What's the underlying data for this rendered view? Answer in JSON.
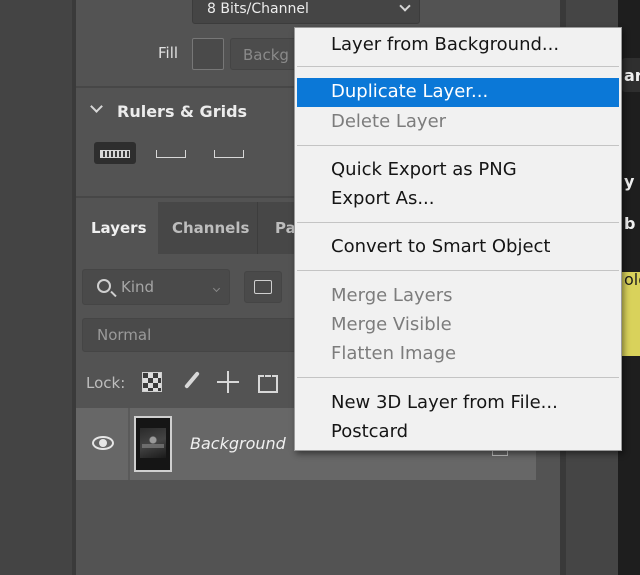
{
  "properties": {
    "bit_depth": "8 Bits/Channel",
    "fill_label": "Fill",
    "fill_value": "Backg",
    "rulers_grids_title": "Rulers & Grids"
  },
  "layers_panel": {
    "tabs": [
      {
        "label": "Layers"
      },
      {
        "label": "Channels"
      },
      {
        "label": "Pa"
      }
    ],
    "filter_kind": "Kind",
    "blend_mode": "Normal",
    "lock_label": "Lock:",
    "layer": {
      "name": "Background"
    }
  },
  "right_panel": {
    "fragments": [
      "ari",
      "y",
      "b",
      "olo"
    ]
  },
  "context_menu": {
    "items": [
      {
        "label": "Layer from Background...",
        "state": "enabled"
      },
      {
        "label": "Duplicate Layer...",
        "state": "highlighted"
      },
      {
        "label": "Delete Layer",
        "state": "disabled"
      },
      {
        "label": "Quick Export as PNG",
        "state": "enabled"
      },
      {
        "label": "Export As...",
        "state": "enabled"
      },
      {
        "label": "Convert to Smart Object",
        "state": "enabled"
      },
      {
        "label": "Merge Layers",
        "state": "disabled"
      },
      {
        "label": "Merge Visible",
        "state": "disabled"
      },
      {
        "label": "Flatten Image",
        "state": "disabled"
      },
      {
        "label": "New 3D Layer from File...",
        "state": "enabled"
      },
      {
        "label": "Postcard",
        "state": "enabled"
      }
    ]
  },
  "colors": {
    "highlight": "#0b78d7",
    "panel": "#535353",
    "menu_bg": "#f1f1f1",
    "yellow_swatch": "#d9d25b"
  }
}
